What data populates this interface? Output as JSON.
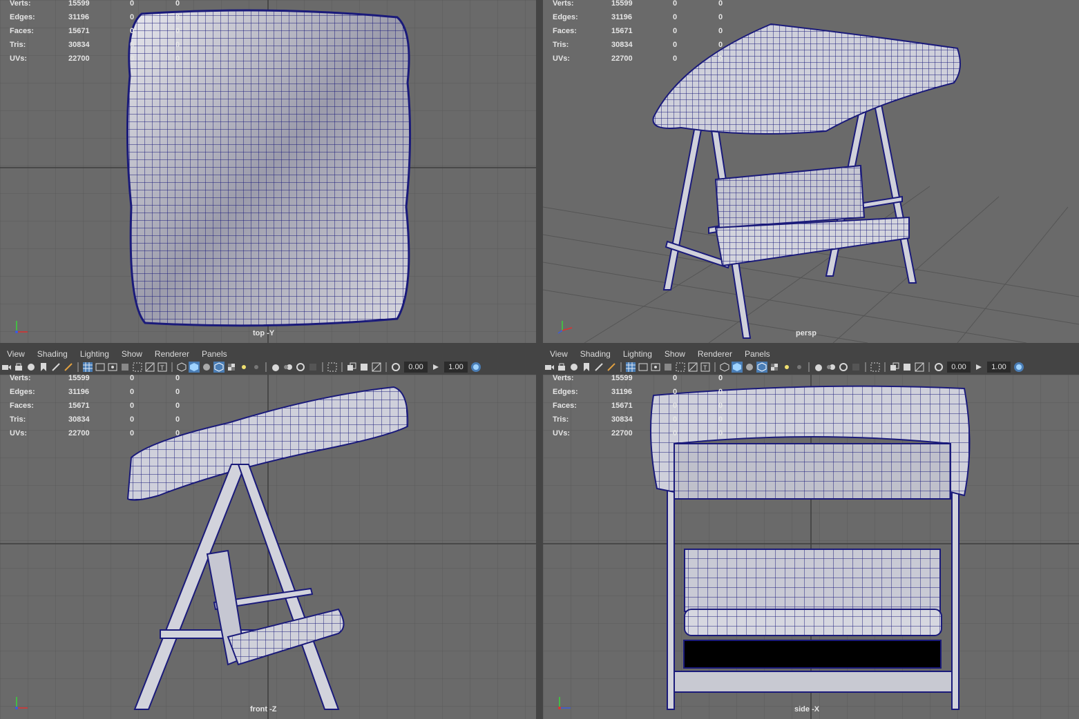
{
  "stats_labels": [
    "Verts:",
    "Edges:",
    "Faces:",
    "Tris:",
    "UVs:"
  ],
  "viewports": {
    "top": {
      "camera_label": "top -Y",
      "stats": [
        [
          "15599",
          "0",
          "0"
        ],
        [
          "31196",
          "0",
          "0"
        ],
        [
          "15671",
          "0",
          "0"
        ],
        [
          "30834",
          "0",
          "0"
        ],
        [
          "22700",
          "0",
          "0"
        ]
      ]
    },
    "persp": {
      "camera_label": "persp",
      "stats": [
        [
          "15599",
          "0",
          "0"
        ],
        [
          "31196",
          "0",
          "0"
        ],
        [
          "15671",
          "0",
          "0"
        ],
        [
          "30834",
          "0",
          "0"
        ],
        [
          "22700",
          "0",
          "0"
        ]
      ]
    },
    "front": {
      "camera_label": "front -Z",
      "stats": [
        [
          "15599",
          "0",
          "0"
        ],
        [
          "31196",
          "0",
          "0"
        ],
        [
          "15671",
          "0",
          "0"
        ],
        [
          "30834",
          "0",
          "0"
        ],
        [
          "22700",
          "0",
          "0"
        ]
      ]
    },
    "side": {
      "camera_label": "side -X",
      "stats": [
        [
          "15599",
          "0",
          "0"
        ],
        [
          "31196",
          "0",
          "0"
        ],
        [
          "15671",
          "0",
          "0"
        ],
        [
          "30834",
          "0",
          "0"
        ],
        [
          "22700",
          "0",
          "0"
        ]
      ]
    }
  },
  "panel_menu": [
    "View",
    "Shading",
    "Lighting",
    "Show",
    "Renderer",
    "Panels"
  ],
  "toolbar": {
    "exposure_value": "0.00",
    "gamma_value": "1.00"
  },
  "colors": {
    "viewport_bg": "#6a6a6a",
    "wire": "#1a1a7a",
    "mesh": "#cfd0db",
    "panel_bar": "#444444"
  }
}
